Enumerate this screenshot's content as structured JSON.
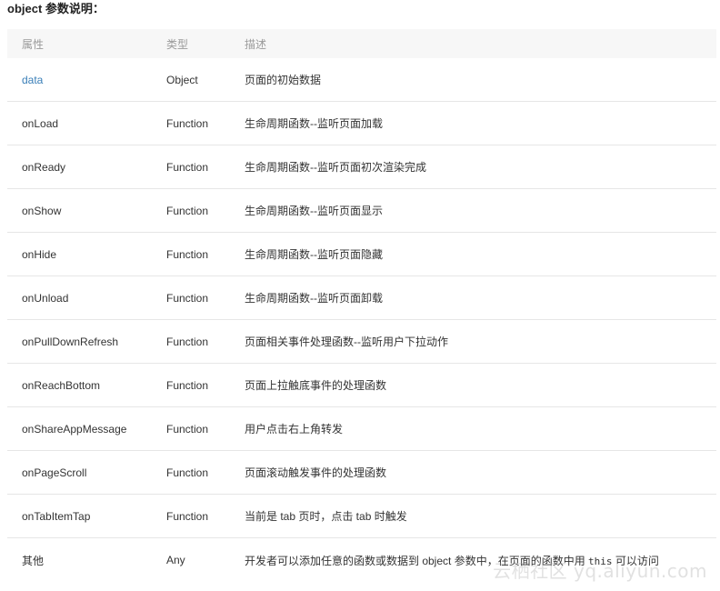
{
  "heading": "object 参数说明：",
  "table": {
    "headers": [
      "属性",
      "类型",
      "描述"
    ],
    "rows": [
      {
        "prop": "data",
        "type": "Object",
        "desc": "页面的初始数据"
      },
      {
        "prop": "onLoad",
        "type": "Function",
        "desc": "生命周期函数--监听页面加载"
      },
      {
        "prop": "onReady",
        "type": "Function",
        "desc": "生命周期函数--监听页面初次渲染完成"
      },
      {
        "prop": "onShow",
        "type": "Function",
        "desc": "生命周期函数--监听页面显示"
      },
      {
        "prop": "onHide",
        "type": "Function",
        "desc": "生命周期函数--监听页面隐藏"
      },
      {
        "prop": "onUnload",
        "type": "Function",
        "desc": "生命周期函数--监听页面卸载"
      },
      {
        "prop": "onPullDownRefresh",
        "type": "Function",
        "desc": "页面相关事件处理函数--监听用户下拉动作"
      },
      {
        "prop": "onReachBottom",
        "type": "Function",
        "desc": "页面上拉触底事件的处理函数"
      },
      {
        "prop": "onShareAppMessage",
        "type": "Function",
        "desc": "用户点击右上角转发"
      },
      {
        "prop": "onPageScroll",
        "type": "Function",
        "desc": "页面滚动触发事件的处理函数"
      },
      {
        "prop": "onTabItemTap",
        "type": "Function",
        "desc": "当前是 tab 页时，点击 tab 时触发"
      },
      {
        "prop": "其他",
        "type": "Any",
        "desc_pre": "开发者可以添加任意的函数或数据到 object 参数中，在页面的函数中用 ",
        "desc_code": "this",
        "desc_post": " 可以访问"
      }
    ]
  },
  "watermark": "云栖社区 yq.aliyun.com",
  "colors": {
    "link": "#3a7fb8",
    "header_bg": "#f7f7f7",
    "row_border": "#e6e6e6"
  }
}
